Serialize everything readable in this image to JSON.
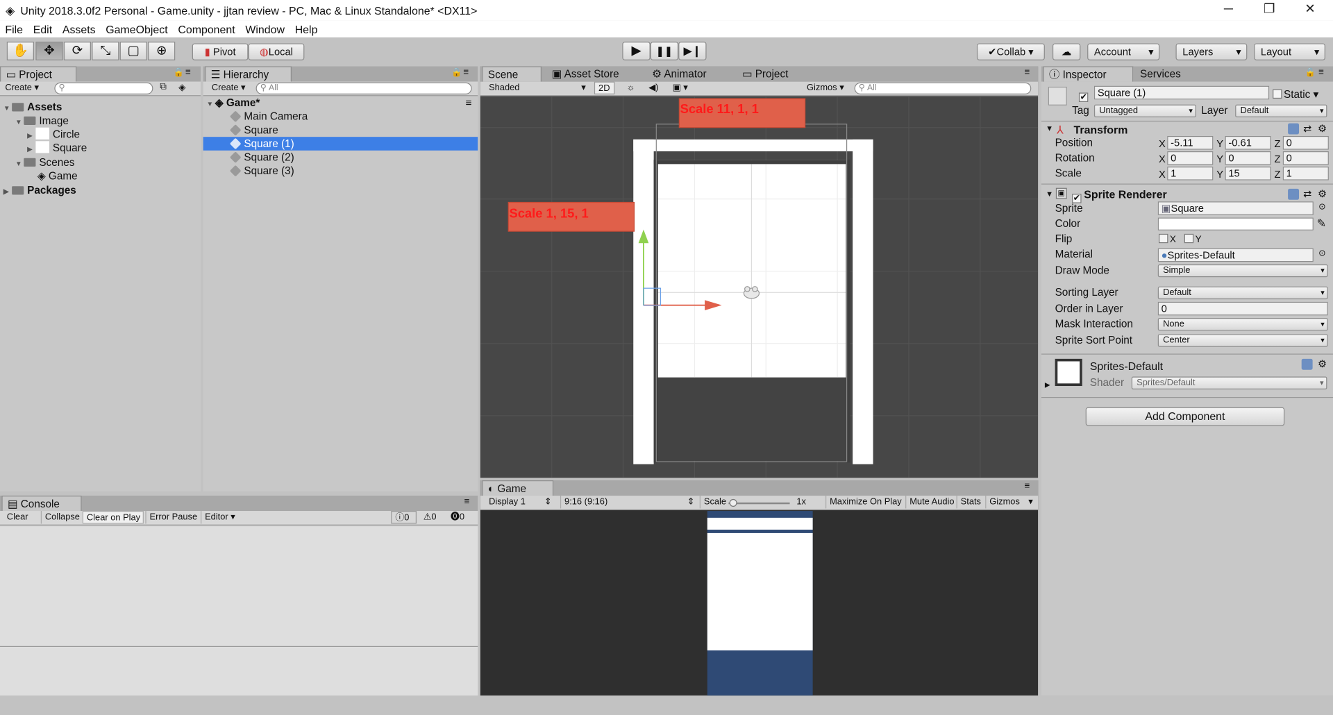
{
  "window": {
    "title": "Unity 2018.3.0f2 Personal - Game.unity - jjtan review - PC, Mac & Linux Standalone* <DX11>",
    "minimize": "─",
    "restore": "❐",
    "close": "✕"
  },
  "menu": [
    "File",
    "Edit",
    "Assets",
    "GameObject",
    "Component",
    "Window",
    "Help"
  ],
  "toolbar": {
    "tools": [
      "hand-tool",
      "move-tool",
      "rotate-tool",
      "scale-tool",
      "rect-tool",
      "transform-tool"
    ],
    "tool_glyphs": [
      "✋",
      "✥",
      "⟳",
      "⤡",
      "▢",
      "⊕"
    ],
    "pivot": "Pivot",
    "local": "Local",
    "play": "▶",
    "pause": "❚❚",
    "step": "▶❙",
    "collab": "Collab",
    "cloud": "☁",
    "account": "Account",
    "layers": "Layers",
    "layout": "Layout"
  },
  "project": {
    "tab": "Project",
    "create": "Create",
    "tree": {
      "assets": "Assets",
      "image": "Image",
      "circle": "Circle",
      "square": "Square",
      "scenes": "Scenes",
      "game": "Game",
      "packages": "Packages"
    }
  },
  "hierarchy": {
    "tab": "Hierarchy",
    "create": "Create",
    "search_placeholder": "All",
    "scene": "Game*",
    "items": [
      "Main Camera",
      "Square",
      "Square (1)",
      "Square (2)",
      "Square (3)"
    ],
    "selected_index": 2
  },
  "scene_view": {
    "tabs": [
      "Scene",
      "Asset Store",
      "Animator",
      "Project"
    ],
    "shaded": "Shaded",
    "mode_2d": "2D",
    "gizmos": "Gizmos",
    "search_placeholder": "All",
    "annotation_top": "Scale 11, 1, 1",
    "annotation_left": "Scale 1, 15, 1"
  },
  "game_view": {
    "tab": "Game",
    "display": "Display 1",
    "aspect": "9:16 (9:16)",
    "scale_label": "Scale",
    "scale_value": "1x",
    "maximize": "Maximize On Play",
    "mute": "Mute Audio",
    "stats": "Stats",
    "gizmos": "Gizmos"
  },
  "console": {
    "tab": "Console",
    "clear": "Clear",
    "collapse": "Collapse",
    "clear_on_play": "Clear on Play",
    "error_pause": "Error Pause",
    "editor": "Editor",
    "info_count": "0",
    "warn_count": "0",
    "error_count": "0"
  },
  "inspector": {
    "tabs": [
      "Inspector",
      "Services"
    ],
    "object_name": "Square (1)",
    "static_label": "Static",
    "tag_label": "Tag",
    "tag_value": "Untagged",
    "layer_label": "Layer",
    "layer_value": "Default",
    "transform": {
      "header": "Transform",
      "position_label": "Position",
      "rotation_label": "Rotation",
      "scale_label": "Scale",
      "position": {
        "x": "-5.11",
        "y": "-0.61",
        "z": "0"
      },
      "rotation": {
        "x": "0",
        "y": "0",
        "z": "0"
      },
      "scale": {
        "x": "1",
        "y": "15",
        "z": "1"
      }
    },
    "sprite_renderer": {
      "header": "Sprite Renderer",
      "sprite_label": "Sprite",
      "sprite_value": "Square",
      "color_label": "Color",
      "flip_label": "Flip",
      "flip_x": "X",
      "flip_y": "Y",
      "material_label": "Material",
      "material_value": "Sprites-Default",
      "draw_mode_label": "Draw Mode",
      "draw_mode_value": "Simple",
      "sorting_layer_label": "Sorting Layer",
      "sorting_layer_value": "Default",
      "order_label": "Order in Layer",
      "order_value": "0",
      "mask_label": "Mask Interaction",
      "mask_value": "None",
      "sort_point_label": "Sprite Sort Point",
      "sort_point_value": "Center"
    },
    "material": {
      "name": "Sprites-Default",
      "shader_label": "Shader",
      "shader_value": "Sprites/Default"
    },
    "add_component": "Add Component",
    "axis": {
      "x": "X",
      "y": "Y",
      "z": "Z"
    }
  },
  "colors": {
    "selection": "#3d7fe6",
    "annotation": "#e0604a",
    "annotation_text": "#ff1a1a",
    "game_blue": "#2f4a75"
  }
}
